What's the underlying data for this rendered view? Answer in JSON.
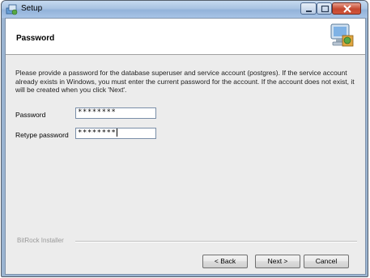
{
  "window": {
    "title": "Setup"
  },
  "header": {
    "title": "Password"
  },
  "description": "Please provide a password for the database superuser and service account (postgres). If the service account already exists in Windows, you must enter the current password for the account. If the account does not exist, it will be created when you click 'Next'.",
  "form": {
    "password_label": "Password",
    "password_value": "********",
    "retype_label": "Retype password",
    "retype_value": "********"
  },
  "footer": {
    "brand": "BitRock Installer",
    "back_label": "< Back",
    "next_label": "Next >",
    "cancel_label": "Cancel"
  }
}
